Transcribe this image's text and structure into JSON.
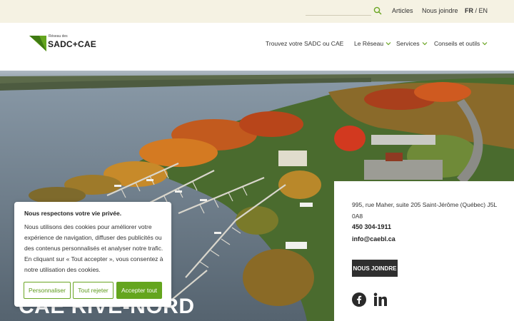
{
  "topbar": {
    "search_icon": "search-icon",
    "links": [
      "Articles",
      "Nous joindre"
    ],
    "lang_fr": "FR",
    "lang_sep": "/",
    "lang_en": "EN"
  },
  "header": {
    "logo_small": "Réseau des",
    "logo_text": "SADC+CAE",
    "nav": {
      "find": "Trouvez votre SADC ou CAE",
      "reseau": "Le Réseau",
      "services": "Services",
      "conseils": "Conseils et outils"
    }
  },
  "hero": {
    "title": "CAE RIVE-NORD"
  },
  "contact": {
    "address": "995, rue Maher, suite 205 Saint-Jérôme (Québec) J5L 0A8",
    "phone": "450 304-1911",
    "email": "info@caebl.ca",
    "join_label": "NOUS JOINDRE",
    "social": [
      "facebook-icon",
      "linkedin-icon"
    ]
  },
  "cookie": {
    "title": "Nous respectons votre vie privée.",
    "body": "Nous utilisons des cookies pour améliorer votre expérience de navigation, diffuser des publicités ou des contenus personnalisés et analyser notre trafic. En cliquant sur « Tout accepter », vous consentez à notre utilisation des cookies.",
    "customize": "Personnaliser",
    "reject": "Tout rejeter",
    "accept": "Accepter tout"
  },
  "colors": {
    "brand_green": "#64a51e",
    "topbar_bg": "#f5f2e3",
    "dark_button": "#2f2f2f"
  }
}
